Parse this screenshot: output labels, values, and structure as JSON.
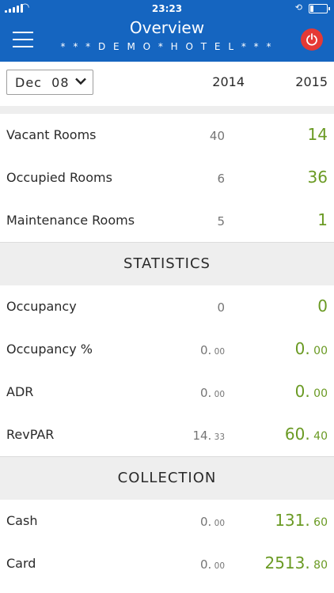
{
  "status": {
    "time": "23:23"
  },
  "header": {
    "title": "Overview",
    "subtitle": "* * * D E M O * H O T E L * * *"
  },
  "date": {
    "selected": "Dec  08"
  },
  "columns": {
    "year1": "2014",
    "year2": "2015"
  },
  "rooms": [
    {
      "label": "Vacant Rooms",
      "v1": "40",
      "v2": "14"
    },
    {
      "label": "Occupied Rooms",
      "v1": "6",
      "v2": "36"
    },
    {
      "label": "Maintenance Rooms",
      "v1": "5",
      "v2": "1"
    }
  ],
  "statistics": {
    "title": "STATISTICS",
    "rows": [
      {
        "label": "Occupancy",
        "v1_int": "0",
        "v1_dec": "",
        "v2_int": "0",
        "v2_dec": ""
      },
      {
        "label": "Occupancy %",
        "v1_int": "0.",
        "v1_dec": " 00",
        "v2_int": "0.",
        "v2_dec": " 00"
      },
      {
        "label": "ADR",
        "v1_int": "0.",
        "v1_dec": " 00",
        "v2_int": "0.",
        "v2_dec": " 00"
      },
      {
        "label": "RevPAR",
        "v1_int": "14.",
        "v1_dec": " 33",
        "v2_int": "60.",
        "v2_dec": " 40"
      }
    ]
  },
  "collection": {
    "title": "COLLECTION",
    "rows": [
      {
        "label": "Cash",
        "v1_int": "0.",
        "v1_dec": " 00",
        "v2_int": "131.",
        "v2_dec": " 60"
      },
      {
        "label": "Card",
        "v1_int": "0.",
        "v1_dec": " 00",
        "v2_int": "2513.",
        "v2_dec": " 80"
      }
    ]
  },
  "colors": {
    "header": "#1565c0",
    "accent_green": "#6a9a23",
    "power": "#e53935",
    "band": "#eeeeee"
  }
}
